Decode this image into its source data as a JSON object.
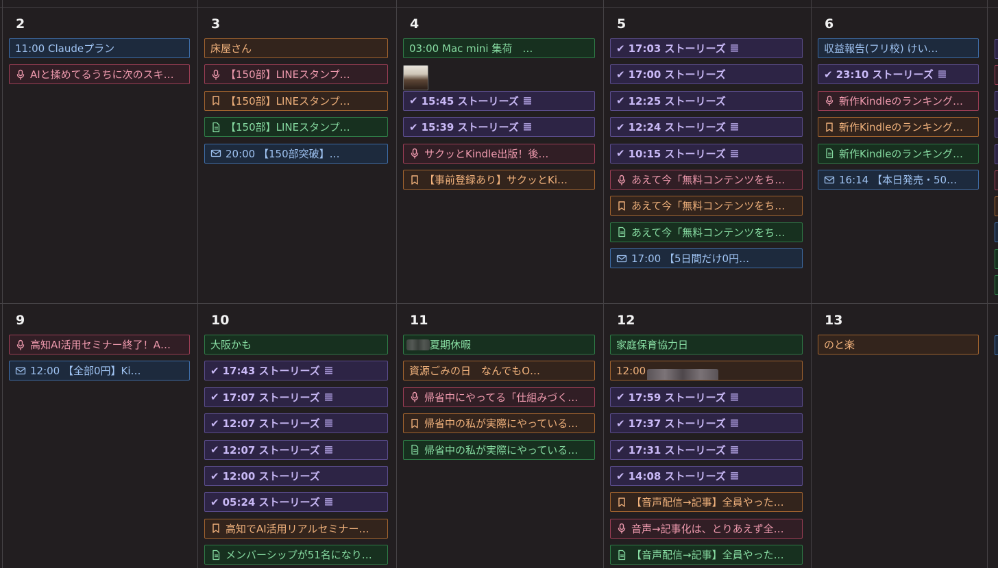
{
  "days": [
    {
      "num": "2",
      "events": [
        {
          "color": "blue",
          "text": "11:00 Claudeプラン"
        },
        {
          "color": "red",
          "icon": "mic",
          "text": "AIと揉めてるうちに次のスキ…"
        }
      ]
    },
    {
      "num": "3",
      "events": [
        {
          "color": "orange",
          "text": "床屋さん"
        },
        {
          "color": "red",
          "icon": "mic",
          "text": "【150部】LINEスタンプ…"
        },
        {
          "color": "orange",
          "icon": "bookmark",
          "text": "【150部】LINEスタンプ…"
        },
        {
          "color": "green",
          "icon": "doc",
          "text": "【150部】LINEスタンプ…"
        },
        {
          "color": "blue",
          "icon": "mail",
          "text": "20:00 【150部突破】…"
        }
      ]
    },
    {
      "num": "4",
      "thumbnail": true,
      "events": [
        {
          "color": "green",
          "text": "03:00 Mac mini 集荷　…"
        },
        {
          "color": "purple",
          "done": true,
          "note": true,
          "text": "15:45 ストーリーズ"
        },
        {
          "color": "purple",
          "done": true,
          "note": true,
          "text": "15:39 ストーリーズ"
        },
        {
          "color": "red",
          "icon": "mic",
          "text": "サクッとKindle出版！後…"
        },
        {
          "color": "orange",
          "icon": "bookmark",
          "text": "【事前登録あり】サクッとKi…"
        }
      ]
    },
    {
      "num": "5",
      "events": [
        {
          "color": "purple",
          "done": true,
          "note": true,
          "text": "17:03 ストーリーズ"
        },
        {
          "color": "purple",
          "done": true,
          "text": "17:00 ストーリーズ"
        },
        {
          "color": "purple",
          "done": true,
          "text": "12:25 ストーリーズ"
        },
        {
          "color": "purple",
          "done": true,
          "note": true,
          "text": "12:24 ストーリーズ"
        },
        {
          "color": "purple",
          "done": true,
          "note": true,
          "text": "10:15 ストーリーズ"
        },
        {
          "color": "red",
          "icon": "mic",
          "text": "あえて今「無料コンテンツをち…"
        },
        {
          "color": "orange",
          "icon": "bookmark",
          "text": "あえて今「無料コンテンツをち…"
        },
        {
          "color": "green",
          "icon": "doc",
          "text": "あえて今「無料コンテンツをち…"
        },
        {
          "color": "blue",
          "icon": "mail",
          "text": "17:00 【5日間だけ0円…"
        }
      ]
    },
    {
      "num": "6",
      "events": [
        {
          "color": "blue",
          "text": "収益報告(フリ校) けい…"
        },
        {
          "color": "purple",
          "done": true,
          "note": true,
          "text": "23:10 ストーリーズ"
        },
        {
          "color": "red",
          "icon": "mic",
          "text": "新作Kindleのランキング…"
        },
        {
          "color": "orange",
          "icon": "bookmark",
          "text": "新作Kindleのランキング…"
        },
        {
          "color": "green",
          "icon": "doc",
          "text": "新作Kindleのランキング…"
        },
        {
          "color": "blue",
          "icon": "mail",
          "text": "16:14 【本日発売・50…"
        }
      ]
    },
    {
      "num": "9",
      "events": [
        {
          "color": "red",
          "icon": "mic",
          "text": "高知AI活用セミナー終了！A…"
        },
        {
          "color": "blue",
          "icon": "mail",
          "text": "12:00 【全部0円】Ki…"
        }
      ]
    },
    {
      "num": "10",
      "events": [
        {
          "color": "green",
          "text": "大阪かも"
        },
        {
          "color": "purple",
          "done": true,
          "note": true,
          "text": "17:43 ストーリーズ"
        },
        {
          "color": "purple",
          "done": true,
          "note": true,
          "text": "17:07 ストーリーズ"
        },
        {
          "color": "purple",
          "done": true,
          "note": true,
          "text": "12:07 ストーリーズ"
        },
        {
          "color": "purple",
          "done": true,
          "note": true,
          "text": "12:07 ストーリーズ"
        },
        {
          "color": "purple",
          "done": true,
          "text": "12:00 ストーリーズ"
        },
        {
          "color": "purple",
          "done": true,
          "note": true,
          "text": "05:24 ストーリーズ"
        },
        {
          "color": "orange",
          "icon": "bookmark",
          "text": "高知でAI活用リアルセミナー…"
        },
        {
          "color": "green",
          "icon": "doc",
          "text": "メンバーシップが51名になり…"
        }
      ]
    },
    {
      "num": "11",
      "events": [
        {
          "color": "green",
          "blurPrefix": true,
          "text": "夏期休暇"
        },
        {
          "color": "orange",
          "text": "資源ごみの日　なんでもO…"
        },
        {
          "color": "red",
          "icon": "mic",
          "text": "帰省中にやってる「仕組みづく…"
        },
        {
          "color": "orange",
          "icon": "bookmark",
          "text": "帰省中の私が実際にやっている…"
        },
        {
          "color": "green",
          "icon": "doc",
          "text": "帰省中の私が実際にやっている…"
        }
      ]
    },
    {
      "num": "12",
      "events": [
        {
          "color": "green",
          "text": "家庭保育協力日"
        },
        {
          "color": "orange",
          "blurSuffix": true,
          "text": "12:00"
        },
        {
          "color": "purple",
          "done": true,
          "note": true,
          "text": "17:59 ストーリーズ"
        },
        {
          "color": "purple",
          "done": true,
          "note": true,
          "text": "17:37 ストーリーズ"
        },
        {
          "color": "purple",
          "done": true,
          "note": true,
          "text": "17:31 ストーリーズ"
        },
        {
          "color": "purple",
          "done": true,
          "note": true,
          "text": "14:08 ストーリーズ"
        },
        {
          "color": "orange",
          "icon": "bookmark",
          "text": "【音声配信→記事】全員やった…"
        },
        {
          "color": "red",
          "icon": "mic",
          "text": "音声→記事化は、とりあえず全…"
        },
        {
          "color": "green",
          "icon": "doc",
          "text": "【音声配信→記事】全員やった…"
        }
      ]
    },
    {
      "num": "13",
      "events": [
        {
          "color": "orange",
          "text": "のと楽"
        }
      ]
    }
  ],
  "icons": {
    "mic": "microphone-icon",
    "bookmark": "bookmark-icon",
    "doc": "document-icon",
    "mail": "mail-icon",
    "check": "check-icon",
    "note": "note-icon"
  },
  "colors": {
    "background": "#221e20",
    "grid": "#454245",
    "blue": "#3e6da8",
    "red": "#9c3e55",
    "orange": "#a2642f",
    "green": "#2f7c47",
    "purple": "#5b4d8c"
  }
}
